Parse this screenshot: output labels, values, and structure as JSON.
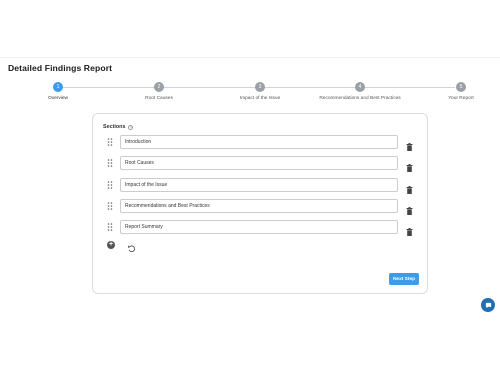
{
  "page": {
    "title": "Detailed Findings Report"
  },
  "stepper": {
    "steps": [
      {
        "number": "1",
        "label": "Overview",
        "active": true
      },
      {
        "number": "2",
        "label": "Root Causes",
        "active": false
      },
      {
        "number": "3",
        "label": "Impact of the Issue",
        "active": false
      },
      {
        "number": "4",
        "label": "Recommendations and Best Practices",
        "active": false
      },
      {
        "number": "5",
        "label": "Your Report",
        "active": false
      }
    ]
  },
  "card": {
    "sections_title": "Sections",
    "info_icon": "info-icon",
    "sections": [
      {
        "value": "Introduction"
      },
      {
        "value": "Root Causes"
      },
      {
        "value": "Impact of the Issue"
      },
      {
        "value": "Recommendations and Best Practices"
      },
      {
        "value": "Report Summary"
      }
    ],
    "next_label": "Next Step"
  },
  "colors": {
    "accent": "#3d9be9",
    "inactive_step": "#9aa0a6",
    "chat": "#1f6fb2"
  }
}
